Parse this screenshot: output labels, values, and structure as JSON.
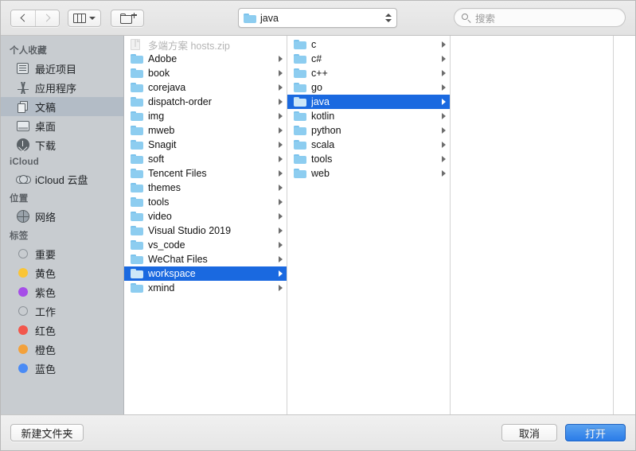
{
  "toolbar": {
    "back_label": "back-arrow",
    "forward_label": "forward-arrow",
    "view_label": "column-view",
    "new_folder_label": "new-folder",
    "path_value": "java",
    "search_placeholder": "搜索"
  },
  "sidebar": {
    "groups": [
      {
        "title": "个人收藏",
        "items": [
          {
            "label": "最近项目",
            "icon": "recents-icon",
            "selected": false
          },
          {
            "label": "应用程序",
            "icon": "applications-icon",
            "selected": false
          },
          {
            "label": "文稿",
            "icon": "documents-icon",
            "selected": true
          },
          {
            "label": "桌面",
            "icon": "desktop-icon",
            "selected": false
          },
          {
            "label": "下载",
            "icon": "downloads-icon",
            "selected": false
          }
        ]
      },
      {
        "title": "iCloud",
        "items": [
          {
            "label": "iCloud 云盘",
            "icon": "icloud-drive-icon",
            "selected": false
          }
        ]
      },
      {
        "title": "位置",
        "items": [
          {
            "label": "网络",
            "icon": "network-icon",
            "selected": false
          }
        ]
      },
      {
        "title": "标签",
        "items": [
          {
            "label": "重要",
            "icon": "tag-dot-icon",
            "color": "ring",
            "selected": false
          },
          {
            "label": "黄色",
            "icon": "tag-dot-icon",
            "color": "#fac536",
            "selected": false
          },
          {
            "label": "紫色",
            "icon": "tag-dot-icon",
            "color": "#a64ee8",
            "selected": false
          },
          {
            "label": "工作",
            "icon": "tag-dot-icon",
            "color": "ring",
            "selected": false
          },
          {
            "label": "红色",
            "icon": "tag-dot-icon",
            "color": "#f2574c",
            "selected": false
          },
          {
            "label": "橙色",
            "icon": "tag-dot-icon",
            "color": "#f3a13b",
            "selected": false
          },
          {
            "label": "蓝色",
            "icon": "tag-dot-icon",
            "color": "#4a8bf5",
            "selected": false
          }
        ]
      }
    ]
  },
  "columns": [
    {
      "name": "column-documents",
      "rows": [
        {
          "label": "多端方案 hosts.zip",
          "type": "file",
          "disabled": true,
          "selected": false,
          "has_children": false
        },
        {
          "label": "Adobe",
          "type": "folder",
          "disabled": false,
          "selected": false,
          "has_children": true
        },
        {
          "label": "book",
          "type": "folder",
          "disabled": false,
          "selected": false,
          "has_children": true
        },
        {
          "label": "corejava",
          "type": "folder",
          "disabled": false,
          "selected": false,
          "has_children": true
        },
        {
          "label": "dispatch-order",
          "type": "folder",
          "disabled": false,
          "selected": false,
          "has_children": true
        },
        {
          "label": "img",
          "type": "folder",
          "disabled": false,
          "selected": false,
          "has_children": true
        },
        {
          "label": "mweb",
          "type": "folder",
          "disabled": false,
          "selected": false,
          "has_children": true
        },
        {
          "label": "Snagit",
          "type": "folder",
          "disabled": false,
          "selected": false,
          "has_children": true
        },
        {
          "label": "soft",
          "type": "folder",
          "disabled": false,
          "selected": false,
          "has_children": true
        },
        {
          "label": "Tencent Files",
          "type": "folder",
          "disabled": false,
          "selected": false,
          "has_children": true
        },
        {
          "label": "themes",
          "type": "folder",
          "disabled": false,
          "selected": false,
          "has_children": true
        },
        {
          "label": "tools",
          "type": "folder",
          "disabled": false,
          "selected": false,
          "has_children": true
        },
        {
          "label": "video",
          "type": "folder",
          "disabled": false,
          "selected": false,
          "has_children": true
        },
        {
          "label": "Visual Studio 2019",
          "type": "folder",
          "disabled": false,
          "selected": false,
          "has_children": true
        },
        {
          "label": "vs_code",
          "type": "folder",
          "disabled": false,
          "selected": false,
          "has_children": true
        },
        {
          "label": "WeChat Files",
          "type": "folder",
          "disabled": false,
          "selected": false,
          "has_children": true
        },
        {
          "label": "workspace",
          "type": "folder",
          "disabled": false,
          "selected": true,
          "has_children": true
        },
        {
          "label": "xmind",
          "type": "folder",
          "disabled": false,
          "selected": false,
          "has_children": true
        }
      ]
    },
    {
      "name": "column-workspace",
      "rows": [
        {
          "label": "c",
          "type": "folder",
          "disabled": false,
          "selected": false,
          "has_children": true
        },
        {
          "label": "c#",
          "type": "folder",
          "disabled": false,
          "selected": false,
          "has_children": true
        },
        {
          "label": "c++",
          "type": "folder",
          "disabled": false,
          "selected": false,
          "has_children": true
        },
        {
          "label": "go",
          "type": "folder",
          "disabled": false,
          "selected": false,
          "has_children": true
        },
        {
          "label": "java",
          "type": "folder",
          "disabled": false,
          "selected": true,
          "has_children": true
        },
        {
          "label": "kotlin",
          "type": "folder",
          "disabled": false,
          "selected": false,
          "has_children": true
        },
        {
          "label": "python",
          "type": "folder",
          "disabled": false,
          "selected": false,
          "has_children": true
        },
        {
          "label": "scala",
          "type": "folder",
          "disabled": false,
          "selected": false,
          "has_children": true
        },
        {
          "label": "tools",
          "type": "folder",
          "disabled": false,
          "selected": false,
          "has_children": true
        },
        {
          "label": "web",
          "type": "folder",
          "disabled": false,
          "selected": false,
          "has_children": true
        }
      ]
    },
    {
      "name": "column-java",
      "rows": []
    },
    {
      "name": "column-preview",
      "rows": []
    }
  ],
  "footer": {
    "new_folder_label": "新建文件夹",
    "cancel_label": "取消",
    "open_label": "打开"
  },
  "colors": {
    "selection_blue": "#1a69e0",
    "primary_button": "#2a7ce8",
    "folder_blue": "#8dcdf0",
    "sidebar_bg": "#c8ccd0"
  }
}
